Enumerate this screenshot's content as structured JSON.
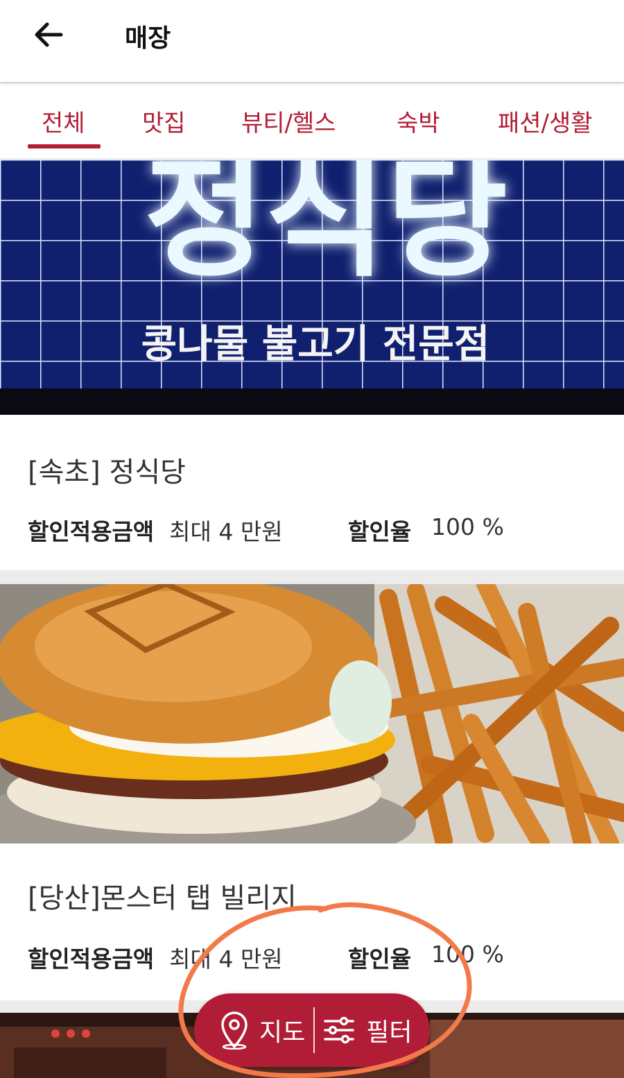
{
  "header": {
    "title": "매장",
    "back_icon": "arrow-left-icon"
  },
  "tabs": [
    {
      "label": "전체",
      "active": true
    },
    {
      "label": "맛집",
      "active": false
    },
    {
      "label": "뷰티/헬스",
      "active": false
    },
    {
      "label": "숙박",
      "active": false
    },
    {
      "label": "패션/생활",
      "active": false
    }
  ],
  "colors": {
    "accent": "#b21e35",
    "annotation": "#f27a4a"
  },
  "stores": [
    {
      "sign_text": "정식당",
      "sign_subtext": "콩나물 불고기 전문점",
      "name": "[속초] 정식당",
      "discount_amount_label": "할인적용금액",
      "discount_amount_value": "최대 4 만원",
      "discount_rate_label": "할인율",
      "discount_rate_value": "100 %"
    },
    {
      "name": "[당산]몬스터 탭 빌리지",
      "discount_amount_label": "할인적용금액",
      "discount_amount_value": "최대 4 만원",
      "discount_rate_label": "할인율",
      "discount_rate_value": "100 %"
    }
  ],
  "fab": {
    "map_label": "지도",
    "map_icon": "map-pin-icon",
    "filter_label": "필터",
    "filter_icon": "sliders-icon"
  }
}
